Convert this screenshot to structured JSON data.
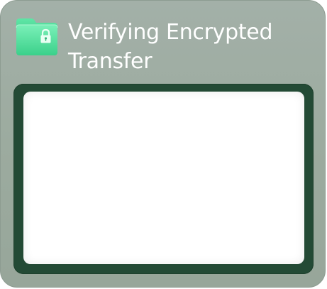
{
  "dialog": {
    "title": "Verifying Encrypted Transfer",
    "icon": "locked-folder-icon"
  },
  "colors": {
    "dialog_background": "#9cab9f",
    "frame": "#234a35",
    "folder_icon": "#3ccf8e",
    "title_text": "#ffffff"
  }
}
